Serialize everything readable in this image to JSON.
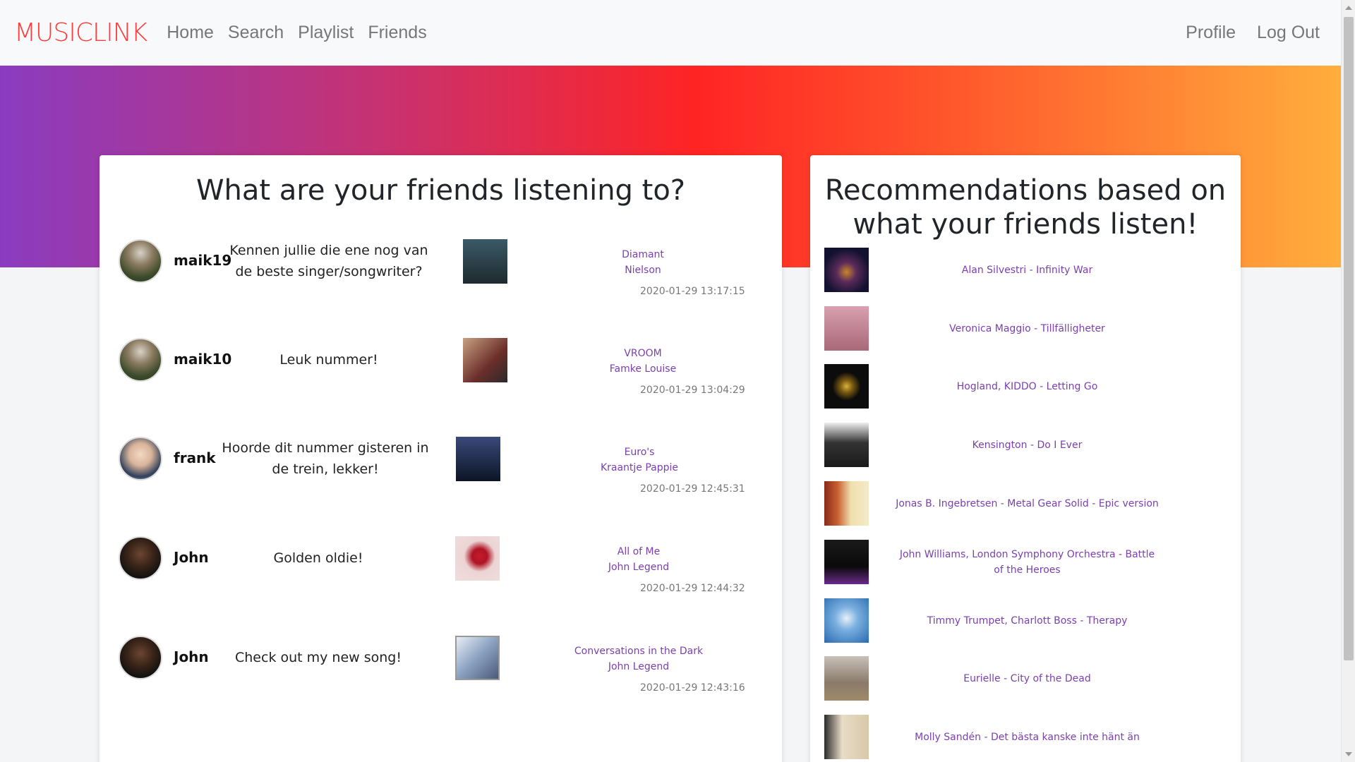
{
  "nav": {
    "brand": "MUSICLINK",
    "links": [
      "Home",
      "Search",
      "Playlist",
      "Friends"
    ],
    "right_links": [
      "Profile",
      "Log Out"
    ]
  },
  "feed": {
    "title": "What are your friends listening to?",
    "items": [
      {
        "user": "maik19",
        "message": "Kennen jullie die ene nog van de beste singer/songwriter?",
        "song": "Diamant",
        "artist": "Nielson",
        "time": "2020-01-29 13:17:15",
        "avatar": "group-photo",
        "cover_color": "#2a3a40"
      },
      {
        "user": "maik10",
        "message": "Leuk nummer!",
        "song": "VROOM",
        "artist": "Famke Louise",
        "time": "2020-01-29 13:04:29",
        "avatar": "group-photo",
        "cover_color": "#8a4a3c"
      },
      {
        "user": "frank",
        "message": "Hoorde dit nummer gisteren in de trein, lekker!",
        "song": "Euro's",
        "artist": "Kraantje Pappie",
        "time": "2020-01-29 12:45:31",
        "avatar": "portrait",
        "cover_color": "#1c2a44"
      },
      {
        "user": "John",
        "message": "Golden oldie!",
        "song": "All of Me",
        "artist": "John Legend",
        "time": "2020-01-29 12:44:32",
        "avatar": "portrait",
        "cover_color": "#e8c8c8"
      },
      {
        "user": "John",
        "message": "Check out my new song!",
        "song": "Conversations in the Dark",
        "artist": "John Legend",
        "time": "2020-01-29 12:43:16",
        "avatar": "portrait",
        "cover_color": "#a8b8cc"
      }
    ]
  },
  "recommendations": {
    "title": "Recommendations based on what your friends listen!",
    "items": [
      {
        "label": "Alan Silvestri - Infinity War",
        "cover_color": "#1a1a3a"
      },
      {
        "label": "Veronica Maggio - Tillfälligheter",
        "cover_color": "#c88c9a"
      },
      {
        "label": "Hogland, KIDDO - Letting Go",
        "cover_color": "#111111"
      },
      {
        "label": "Kensington - Do I Ever",
        "cover_color": "#d8d8d8"
      },
      {
        "label": "Jonas B. Ingebretsen - Metal Gear Solid - Epic version",
        "cover_color": "#e8d8a8"
      },
      {
        "label": "John Williams, London Symphony Orchestra - Battle of the Heroes",
        "cover_color": "#0c0c0c"
      },
      {
        "label": "Timmy Trumpet, Charlott Boss - Therapy",
        "cover_color": "#4a8ac8"
      },
      {
        "label": "Eurielle - City of the Dead",
        "cover_color": "#b8aca0"
      },
      {
        "label": "Molly Sandén - Det bästa kanske inte hänt än",
        "cover_color": "#d8cfc0"
      }
    ]
  }
}
